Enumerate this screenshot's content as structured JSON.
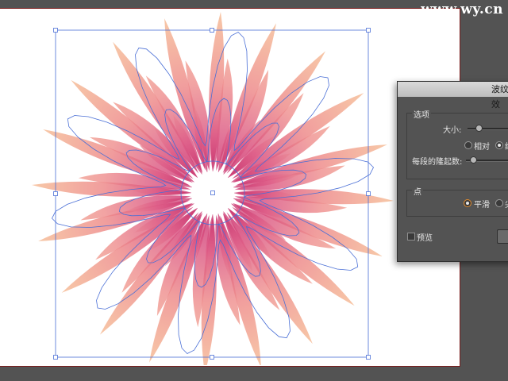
{
  "watermark": "www.wy.cn",
  "dialog": {
    "title": "波纹效",
    "options_group": {
      "label": "选项",
      "size_label": "大小:",
      "size_value_fraction": 0.05,
      "relative_label": "相对",
      "absolute_label_partial": "绝",
      "absolute_selected": true,
      "ridges_label": "每段的隆起数:",
      "ridges_value_fraction": 0.03
    },
    "points_group": {
      "label": "点",
      "smooth_label": "平滑",
      "smooth_selected": true,
      "corner_label_partial": "尖"
    },
    "preview_label": "预览",
    "preview_checked": false
  },
  "colors": {
    "pasteboard": "#535353",
    "artboard_border": "#7a1c1c",
    "petal_outer": "#f1a58c",
    "petal_inner": "#d2497a",
    "selection": "#4a6fd6",
    "radio_accent": "#e08a2e"
  }
}
